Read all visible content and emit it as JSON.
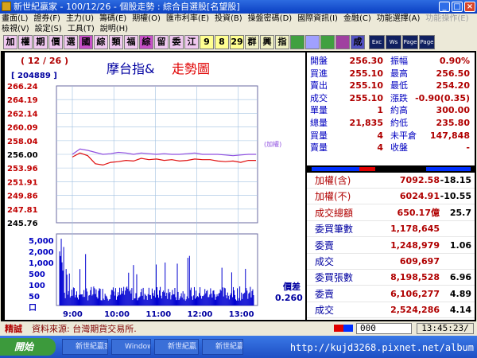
{
  "window": {
    "title": "新世紀贏家 - 100/12/26 - 個股走勢 : 綜合自選股[名望股]",
    "buttons": {
      "min": "_",
      "max": "□",
      "close": "×"
    }
  },
  "menu": {
    "row1": [
      "畫面(L)",
      "證券(F)",
      "主力(U)",
      "籌碼(E)",
      "期權(O)",
      "匯市利率(E)",
      "投資(B)",
      "操盤密碼(D)",
      "國際資訊(I)",
      "金融(C)",
      "功能選擇(A)"
    ],
    "row1_disabled": "功能操作(E)",
    "row2": [
      "檢視(V)",
      "設定(S)",
      "工具(T)",
      "說明(H)"
    ]
  },
  "toolbar": {
    "buttons": [
      "加",
      "權",
      "期",
      "價",
      "選",
      "國",
      "綜",
      "類",
      "福",
      "綜",
      "留",
      "委",
      "江",
      "9",
      "8",
      "29",
      "群",
      "興",
      "指",
      "",
      "",
      "",
      "",
      "成"
    ],
    "small": [
      "Exc",
      "Ws",
      "Page",
      "Page"
    ]
  },
  "chart": {
    "date_label": "( 12 / 26 )",
    "volume_label": "[ 204889 ]",
    "title_a": "摩台指&",
    "title_b": "走勢圖",
    "ref_tag": "(加權)",
    "price_ticks": [
      "266.24",
      "264.19",
      "262.14",
      "260.09",
      "258.04",
      "256.00",
      "253.96",
      "251.91",
      "249.86",
      "247.81",
      "245.76"
    ],
    "vol_ticks": [
      "5,000",
      "2,000",
      "1,000",
      "500",
      "100",
      "50",
      "口"
    ],
    "time_ticks": [
      "9:00",
      "10:00",
      "11:00",
      "12:00",
      "13:00"
    ],
    "diff_label": "價差",
    "diff_value": "0.260"
  },
  "chart_data": {
    "type": "line",
    "x_labels": [
      "9:00",
      "10:00",
      "11:00",
      "12:00",
      "13:00"
    ],
    "ylim": [
      245.76,
      266.24
    ],
    "series": [
      {
        "name": "摩台指",
        "color": "#e01010",
        "values": [
          255.6,
          256.2,
          255.8,
          254.6,
          254.4,
          254.8,
          254.9,
          255.1,
          255.0,
          255.4,
          255.2,
          255.3,
          255.1,
          255.2,
          255.0,
          255.1,
          255.3,
          255.2,
          255.2,
          255.0,
          254.9,
          255.0,
          254.8,
          255.1,
          255.1
        ]
      },
      {
        "name": "加權",
        "color": "#9050e0",
        "values": [
          256.0,
          256.8,
          256.6,
          256.3,
          256.0,
          256.1,
          256.3,
          256.2,
          256.0,
          256.2,
          256.1,
          256.0,
          256.1,
          256.0,
          256.0,
          256.1,
          256.2,
          256.0,
          256.0,
          256.0,
          255.9,
          255.8,
          255.9,
          256.0,
          256.0
        ]
      }
    ]
  },
  "quote": {
    "rows": [
      {
        "l1": "開盤",
        "v1": "256.30",
        "l2": "振幅",
        "v2": "0.90%"
      },
      {
        "l1": "買進",
        "v1": "255.10",
        "l2": "最高",
        "v2": "256.50"
      },
      {
        "l1": "賣出",
        "v1": "255.10",
        "l2": "最低",
        "v2": "254.20"
      },
      {
        "l1": "成交",
        "v1": "255.10",
        "l2": "漲跌",
        "v2": "-0.90(0.35)"
      },
      {
        "l1": "單量",
        "v1": "1",
        "l2": "約高",
        "v2": "300.00"
      },
      {
        "l1": "總量",
        "v1": "21,835",
        "l2": "約低",
        "v2": "235.80"
      },
      {
        "l1": "買量",
        "v1": "4",
        "l2": "未平倉",
        "v2": "147,848"
      },
      {
        "l1": "賣量",
        "v1": "4",
        "l2": "收盤",
        "v2": "-"
      }
    ]
  },
  "quote2": {
    "rows": [
      {
        "l": "加權(含)",
        "v": "7092.58",
        "c": "-18.15",
        "lc": "#b00000"
      },
      {
        "l": "加權(不)",
        "v": "6024.91",
        "c": "-10.55",
        "lc": "#b00000"
      },
      {
        "l": "成交總額",
        "v": "650.17億",
        "c": "25.7",
        "lc": "#b00000"
      },
      {
        "l": "委買筆數",
        "v": "1,178,645",
        "c": "",
        "lc": "#0000a0"
      },
      {
        "l": "委賣",
        "v": "1,248,979",
        "c": "1.06",
        "lc": "#0000a0"
      },
      {
        "l": "成交",
        "v": "609,697",
        "c": "",
        "lc": "#0000a0"
      },
      {
        "l": "委買張數",
        "v": "8,198,528",
        "c": "6.96",
        "lc": "#0000a0"
      },
      {
        "l": "委賣",
        "v": "6,106,277",
        "c": "4.89",
        "lc": "#0000a0"
      },
      {
        "l": "成交",
        "v": "2,524,286",
        "c": "4.14",
        "lc": "#0000a0"
      }
    ]
  },
  "status": {
    "label": "精誠",
    "source": "資料來源: 台灣期貨交易所.",
    "input": "000",
    "clock": "13:45:23/"
  },
  "taskbar": {
    "start": "開始",
    "items": [
      "新世紀贏家",
      "Windows...",
      "新世紀贏",
      "新世紀贏"
    ],
    "watermark": "http://kujd3268.pixnet.net/album"
  },
  "colors": {
    "accent": "#0a3fc2",
    "up": "#e01010",
    "avg": "#9050e0",
    "volume": "#0000d0"
  }
}
